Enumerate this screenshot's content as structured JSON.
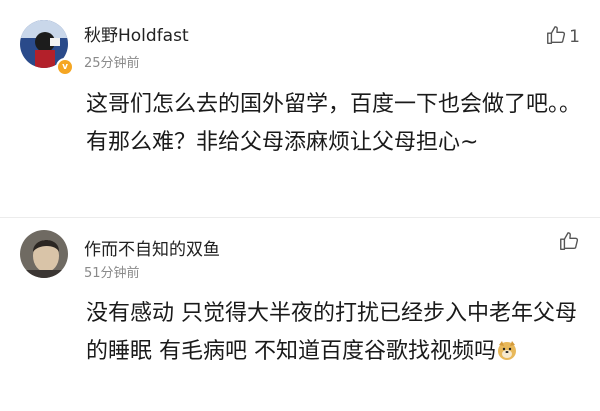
{
  "comments": [
    {
      "username": "秋野Holdfast",
      "time": "25分钟前",
      "like_count": "1",
      "text": "这哥们怎么去的国外留学，百度一下也会做了吧。。有那么难？非给父母添麻烦让父母担心~",
      "avatar_icon": "profile-avatar",
      "badge_icon": "verified-badge-icon",
      "badge_color": "#f5a623"
    },
    {
      "username": "作而不自知的双鱼",
      "time": "51分钟前",
      "like_count": "",
      "text": "没有感动 只觉得大半夜的打扰已经步入中老年父母的睡眠 有毛病吧 不知道百度谷歌找视频吗",
      "avatar_icon": "profile-avatar",
      "emoji_icon": "doge-emoji-icon"
    }
  ]
}
